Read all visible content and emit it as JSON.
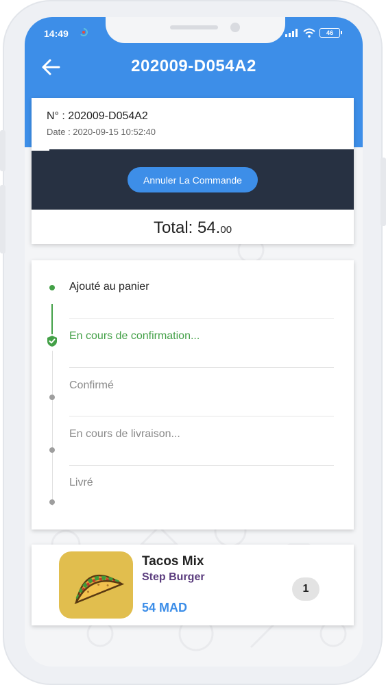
{
  "status_bar": {
    "time": "14:49",
    "battery": "46"
  },
  "header": {
    "title": "202009-D054A2"
  },
  "order": {
    "number": "N° : 202009-D054A2",
    "date": "Date : 2020-09-15 10:52:40",
    "cancel_label": "Annuler La Commande",
    "total_label": "Total: 54.",
    "total_decimals": "00"
  },
  "timeline": {
    "steps": [
      {
        "label": "Ajouté au panier",
        "state": "done"
      },
      {
        "label": "En cours de confirmation...",
        "state": "current"
      },
      {
        "label": "Confirmé",
        "state": "pending"
      },
      {
        "label": "En cours de livraison...",
        "state": "pending"
      },
      {
        "label": "Livré",
        "state": "pending"
      }
    ]
  },
  "product": {
    "name": "Tacos Mix",
    "store": "Step Burger",
    "price": "54 MAD",
    "quantity": "1"
  },
  "colors": {
    "accent": "#3d8ee8",
    "dark_band": "#273142",
    "done": "#43a047",
    "pending": "#9e9e9e",
    "store": "#5b3d7e"
  },
  "icons": {
    "back": "arrow-left-icon",
    "current_step": "shield-check-icon"
  }
}
